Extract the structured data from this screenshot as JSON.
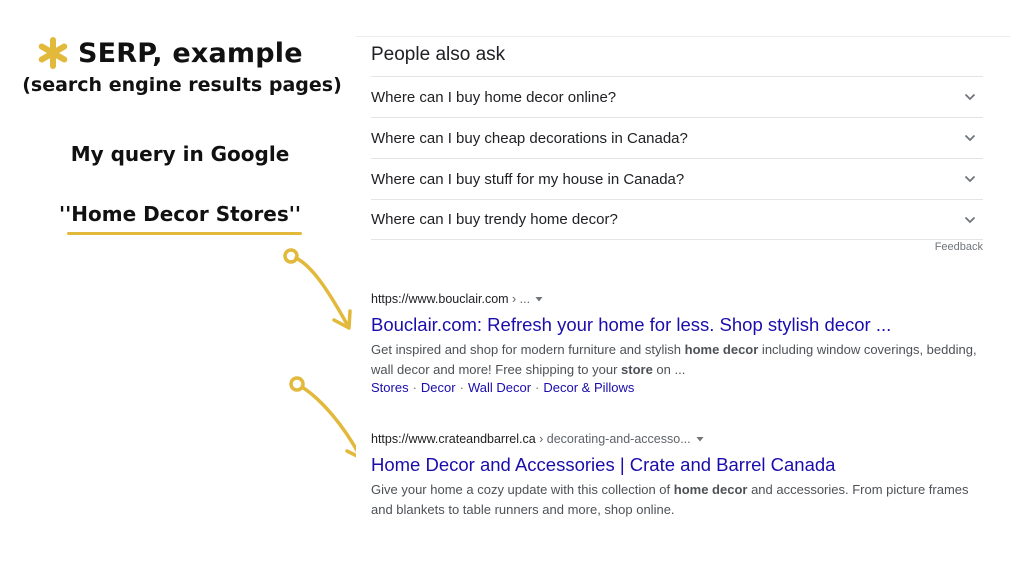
{
  "annotation": {
    "title": "SERP, example",
    "subtitle": "(search engine results pages)",
    "query_label": "My query in Google",
    "query_text": "''Home Decor Stores''",
    "accent_color": "#e2b93b"
  },
  "serp": {
    "people_also_ask": {
      "title": "People also ask",
      "questions": [
        "Where can I buy home decor online?",
        "Where can I buy cheap decorations in Canada?",
        "Where can I buy stuff for my house in Canada?",
        "Where can I buy trendy home decor?"
      ],
      "feedback_label": "Feedback"
    },
    "results": [
      {
        "url_domain": "https://www.bouclair.com",
        "url_path": " › ...",
        "title": "Bouclair.com: Refresh your home for less. Shop stylish decor ...",
        "snippet_parts": [
          "Get inspired and shop for modern furniture and stylish ",
          "home decor",
          " including window coverings, bedding, wall decor and more! Free shipping to your ",
          "store",
          " on ..."
        ],
        "sitelinks": [
          "Stores",
          "Decor",
          "Wall Decor",
          "Decor & Pillows"
        ]
      },
      {
        "url_domain": "https://www.crateandbarrel.ca",
        "url_path": " › decorating-and-accesso...",
        "title": "Home Decor and Accessories | Crate and Barrel Canada",
        "snippet_parts": [
          "Give your home a cozy update with this collection of ",
          "home decor",
          " and accessories. From picture frames and blankets to table runners and more, shop online."
        ]
      }
    ],
    "colors": {
      "link": "#1a0dab",
      "snippet": "#4d5156",
      "text": "#202124"
    }
  },
  "icons": {
    "title_marker": "asterisk-icon",
    "expand": "chevron-down-icon",
    "url_menu": "caret-down-icon",
    "pointer": "curved-arrow-icon"
  }
}
